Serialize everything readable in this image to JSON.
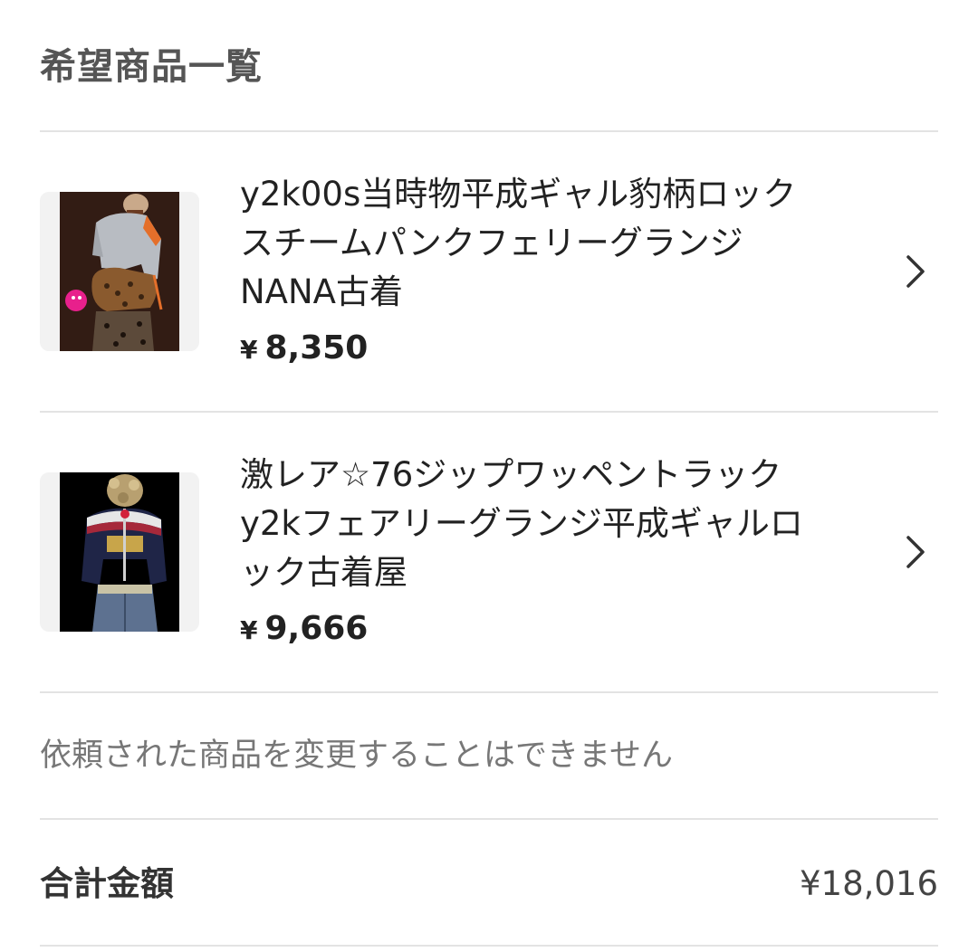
{
  "header": {
    "title": "希望商品一覧"
  },
  "items": [
    {
      "title": "y2k00s当時物平成ギャル豹柄ロック\nスチームパンクフェリーグランジ\nNANA古着",
      "currency": "¥",
      "price": "8,350",
      "thumbnail": "product-photo-leopard-bag-outfit",
      "chevron_icon": "chevron-right-icon"
    },
    {
      "title": "激レア☆76ジップワッペントラック\ny2kフェアリーグランジ平成ギャルロ\nック古着屋",
      "currency": "¥",
      "price": "9,666",
      "thumbnail": "product-photo-track-jacket-outfit",
      "chevron_icon": "chevron-right-icon"
    }
  ],
  "note": "依頼された商品を変更することはできません",
  "total": {
    "label": "合計金額",
    "value": "¥18,016"
  },
  "colors": {
    "text": "#222222",
    "muted": "#777777",
    "divider": "#e3e3e3",
    "thumb_bg": "#f2f2f2"
  }
}
